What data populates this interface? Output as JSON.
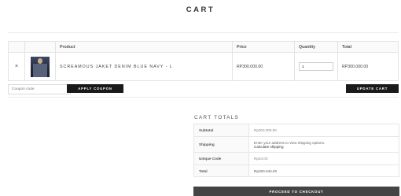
{
  "page": {
    "title": "CART"
  },
  "cart_table": {
    "headers": {
      "remove": "",
      "thumb": "",
      "product": "Product",
      "price": "Price",
      "quantity": "Quantity",
      "total": "Total"
    },
    "rows": [
      {
        "remove_icon": "×",
        "product": "SCREAMOUS JAKET DENIM BLUE NAVY - L",
        "price": "RP300.000.00",
        "quantity": "1",
        "total": "RP300.000.00"
      }
    ]
  },
  "coupon": {
    "placeholder": "Coupon code",
    "apply_label": "APPLY COUPON"
  },
  "update_label": "UPDATE CART",
  "totals": {
    "title": "CART TOTALS",
    "subtotal_label": "Subtotal",
    "subtotal_value": "Rp300.000.00",
    "shipping_label": "Shipping",
    "shipping_text": "Enter your address to view shipping options.",
    "shipping_link": "Calculate shipping",
    "unique_label": "Unique Code",
    "unique_value": "Rp43.00",
    "total_label": "Total",
    "total_value": "Rp300.043.00"
  },
  "checkout_label": "PROCEED TO CHECKOUT"
}
